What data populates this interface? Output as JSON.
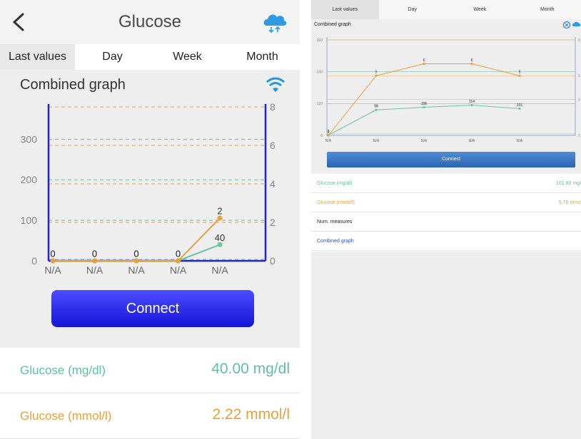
{
  "left": {
    "header": {
      "title": "Glucose",
      "back_icon": "back-chevron-icon",
      "sync_icon": "cloud-sync-icon"
    },
    "tabs": [
      {
        "label": "Last values",
        "active": true
      },
      {
        "label": "Day",
        "active": false
      },
      {
        "label": "Week",
        "active": false
      },
      {
        "label": "Month",
        "active": false
      }
    ],
    "graph": {
      "title": "Combined graph",
      "signal_icon": "wifi-icon"
    },
    "connect_label": "Connect",
    "readings": [
      {
        "label": "Glucose (mg/dl)",
        "value": "40.00 mg/dl",
        "color": "#5fbf9f"
      },
      {
        "label": "Glucose (mmol/l)",
        "value": "2.22 mmol/l",
        "color": "#e8a13a"
      }
    ]
  },
  "right": {
    "tabs": [
      {
        "label": "Last values",
        "active": true
      },
      {
        "label": "Day",
        "active": false
      },
      {
        "label": "Week",
        "active": false
      },
      {
        "label": "Month",
        "active": false
      }
    ],
    "graph": {
      "title": "Combined graph"
    },
    "connect_label": "Connect",
    "rows": [
      {
        "label": "Glucose (mg/dl)",
        "value": "101.80 mg/",
        "color": "#5fbf9f"
      },
      {
        "label": "Glucose (mmol/l)",
        "value": "5.76 mmo",
        "color": "#e8a13a"
      },
      {
        "label": "Num. measures",
        "value": "",
        "color": "#222222"
      },
      {
        "label": "Combined graph",
        "value": "",
        "color": "#2250c6"
      }
    ]
  },
  "chart_data": [
    {
      "type": "line",
      "title": "Combined graph",
      "categories": [
        "N/A",
        "N/A",
        "N/A",
        "N/A",
        "N/A"
      ],
      "y_left": {
        "ticks": [
          0,
          100,
          200,
          300
        ],
        "range": [
          0,
          380
        ]
      },
      "y_right": {
        "ticks": [
          0,
          2,
          4,
          6,
          8
        ],
        "range": [
          0,
          8
        ]
      },
      "series": [
        {
          "axis": "left",
          "color": "#6cc5a3",
          "values": [
            0,
            0,
            0,
            0,
            40
          ],
          "labels": [
            "0",
            "0",
            "0",
            "0",
            "40"
          ]
        },
        {
          "axis": "right",
          "color": "#e8a13a",
          "values": [
            0,
            0,
            0,
            0,
            2.22
          ],
          "labels": [
            "0",
            "0",
            "0",
            "0",
            "2"
          ]
        }
      ],
      "grid": true
    },
    {
      "type": "line",
      "title": "Combined graph",
      "categories": [
        "N/A",
        "N/A",
        "N/A",
        "N/A",
        "N/A"
      ],
      "y_left": {
        "ticks": [
          0,
          120,
          240,
          360
        ],
        "range": [
          0,
          360
        ]
      },
      "y_right": {
        "ticks": [
          0,
          3,
          5,
          8
        ],
        "range": [
          0,
          8
        ]
      },
      "series": [
        {
          "axis": "left",
          "color": "#6cc5a3",
          "values": [
            1,
            96,
            106,
            114,
            101
          ],
          "labels": [
            "1",
            "96",
            "106",
            "114",
            "101"
          ]
        },
        {
          "axis": "right",
          "color": "#e8a13a",
          "values": [
            0,
            5,
            6,
            6,
            5
          ],
          "labels": [
            "0",
            "5",
            "6",
            "6",
            "5"
          ]
        }
      ],
      "grid": true
    }
  ]
}
